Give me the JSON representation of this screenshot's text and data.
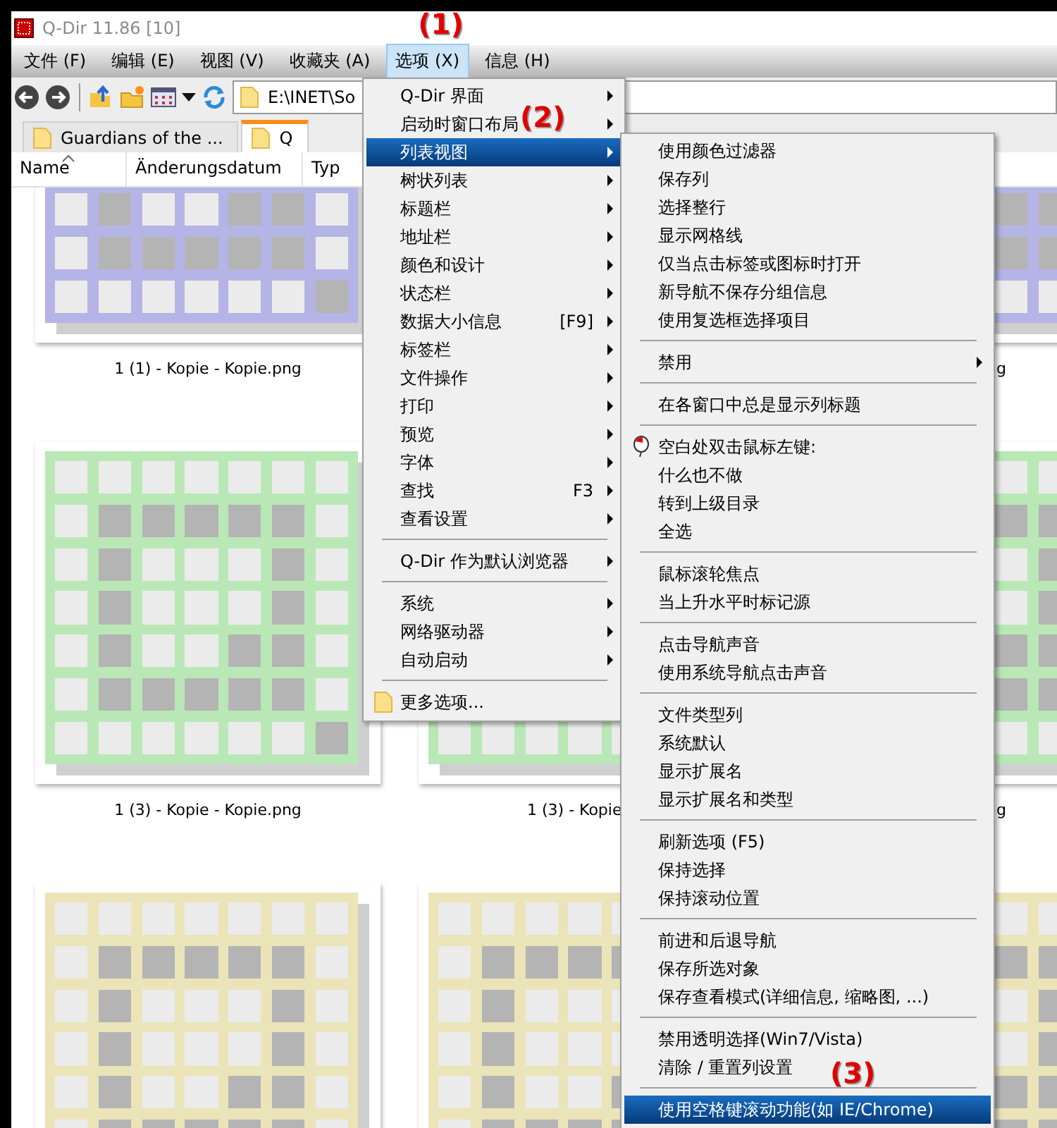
{
  "window": {
    "title": "Q-Dir 11.86 [10]"
  },
  "menu_bar": [
    {
      "label": "文件 (F)",
      "selected": false
    },
    {
      "label": "编辑 (E)",
      "selected": false
    },
    {
      "label": "视图 (V)",
      "selected": false
    },
    {
      "label": "收藏夹 (A)",
      "selected": false
    },
    {
      "label": "选项 (X)",
      "selected": true,
      "annotation": "(1)"
    },
    {
      "label": "信息 (H)",
      "selected": false
    }
  ],
  "toolbar": {
    "address": "E:\\INET\\So"
  },
  "tabs": [
    {
      "label": "Guardians of the ...",
      "selected": false
    },
    {
      "label": "Q",
      "selected": true
    }
  ],
  "columns": [
    "Name",
    "Änderungsdatum",
    "Typ"
  ],
  "thumbnails": [
    {
      "color": "#b4b4e6",
      "label": "1 (1) - Kopie - Kopie.png"
    },
    {
      "color": "#b4b4e6",
      "label": "g"
    },
    {
      "color": "#b9e8b6",
      "label": "1 (3) - Kopie - Kopie.png"
    },
    {
      "color": "#b9e8b6",
      "label": "1 (3) - Kopie"
    },
    {
      "color": "#b9e8b6",
      "label": "g"
    },
    {
      "color": "#ebe4b9"
    },
    {
      "color": "#ebe4b9"
    },
    {
      "color": "#ebe4b9"
    }
  ],
  "options_menu": [
    {
      "kind": "item",
      "label": "Q-Dir 界面",
      "submenu": true,
      "selected": false
    },
    {
      "kind": "item",
      "label": "启动时窗口布局",
      "submenu": true,
      "selected": false,
      "annotation": "(2)"
    },
    {
      "kind": "item",
      "label": "列表视图",
      "submenu": true,
      "selected": true
    },
    {
      "kind": "item",
      "label": "树状列表",
      "submenu": true,
      "selected": false
    },
    {
      "kind": "item",
      "label": "标题栏",
      "submenu": true,
      "selected": false
    },
    {
      "kind": "item",
      "label": "地址栏",
      "submenu": true,
      "selected": false
    },
    {
      "kind": "item",
      "label": "颜色和设计",
      "submenu": true,
      "selected": false
    },
    {
      "kind": "item",
      "label": "状态栏",
      "submenu": true,
      "selected": false
    },
    {
      "kind": "item",
      "label": "数据大小信息",
      "shortcut": "[F9]",
      "submenu": true,
      "selected": false
    },
    {
      "kind": "item",
      "label": "标签栏",
      "submenu": true,
      "selected": false
    },
    {
      "kind": "item",
      "label": "文件操作",
      "submenu": true,
      "selected": false
    },
    {
      "kind": "item",
      "label": "打印",
      "submenu": true,
      "selected": false
    },
    {
      "kind": "item",
      "label": "预览",
      "submenu": true,
      "selected": false
    },
    {
      "kind": "item",
      "label": "字体",
      "submenu": true,
      "selected": false
    },
    {
      "kind": "item",
      "label": "查找",
      "shortcut": "F3",
      "submenu": true,
      "selected": false
    },
    {
      "kind": "item",
      "label": "查看设置",
      "submenu": true,
      "selected": false
    },
    {
      "kind": "separator"
    },
    {
      "kind": "item",
      "label": "Q-Dir 作为默认浏览器",
      "submenu": true,
      "selected": false
    },
    {
      "kind": "separator"
    },
    {
      "kind": "item",
      "label": "系统",
      "submenu": true,
      "selected": false
    },
    {
      "kind": "item",
      "label": "网络驱动器",
      "submenu": true,
      "selected": false
    },
    {
      "kind": "item",
      "label": "自动启动",
      "submenu": true,
      "selected": false
    },
    {
      "kind": "separator"
    },
    {
      "kind": "folder",
      "label": "更多选项...",
      "submenu": false,
      "selected": false
    }
  ],
  "list_view_submenu": [
    {
      "kind": "item",
      "label": "使用颜色过滤器",
      "submenu": false,
      "selected": false
    },
    {
      "kind": "item",
      "label": "保存列",
      "submenu": false,
      "selected": false
    },
    {
      "kind": "item",
      "label": "选择整行",
      "submenu": false,
      "selected": false
    },
    {
      "kind": "item",
      "label": "显示网格线",
      "submenu": false,
      "selected": false
    },
    {
      "kind": "item",
      "label": "仅当点击标签或图标时打开",
      "submenu": false,
      "selected": false
    },
    {
      "kind": "item",
      "label": "新导航不保存分组信息",
      "submenu": false,
      "selected": false
    },
    {
      "kind": "item",
      "label": "使用复选框选择项目",
      "submenu": false,
      "selected": false
    },
    {
      "kind": "separator"
    },
    {
      "kind": "item",
      "label": "禁用",
      "submenu": true,
      "selected": false
    },
    {
      "kind": "separator"
    },
    {
      "kind": "item",
      "label": "在各窗口中总是显示列标题",
      "submenu": false,
      "selected": false
    },
    {
      "kind": "separator"
    },
    {
      "kind": "header",
      "label": "空白处双击鼠标左键:",
      "submenu": false,
      "selected": false
    },
    {
      "kind": "item",
      "label": "什么也不做",
      "submenu": false,
      "selected": false
    },
    {
      "kind": "item",
      "label": "转到上级目录",
      "submenu": false,
      "selected": false
    },
    {
      "kind": "item",
      "label": "全选",
      "submenu": false,
      "selected": false
    },
    {
      "kind": "separator"
    },
    {
      "kind": "item",
      "label": "鼠标滚轮焦点",
      "submenu": false,
      "selected": false
    },
    {
      "kind": "item",
      "label": "当上升水平时标记源",
      "submenu": false,
      "selected": false
    },
    {
      "kind": "separator"
    },
    {
      "kind": "item",
      "label": "点击导航声音",
      "submenu": false,
      "selected": false
    },
    {
      "kind": "item",
      "label": "使用系统导航点击声音",
      "submenu": false,
      "selected": false
    },
    {
      "kind": "separator"
    },
    {
      "kind": "item",
      "label": "文件类型列",
      "submenu": false,
      "selected": false
    },
    {
      "kind": "item",
      "label": "系统默认",
      "submenu": false,
      "selected": false
    },
    {
      "kind": "item",
      "label": "显示扩展名",
      "submenu": false,
      "selected": false
    },
    {
      "kind": "item",
      "label": "显示扩展名和类型",
      "submenu": false,
      "selected": false
    },
    {
      "kind": "separator"
    },
    {
      "kind": "item",
      "label": "刷新选项 (F5)",
      "submenu": false,
      "selected": false
    },
    {
      "kind": "item",
      "label": "保持选择",
      "submenu": false,
      "selected": false
    },
    {
      "kind": "item",
      "label": "保持滚动位置",
      "submenu": false,
      "selected": false
    },
    {
      "kind": "separator"
    },
    {
      "kind": "item",
      "label": "前进和后退导航",
      "submenu": false,
      "selected": false
    },
    {
      "kind": "item",
      "label": "保存所选对象",
      "submenu": false,
      "selected": false
    },
    {
      "kind": "item",
      "label": "保存查看模式(详细信息, 缩略图, ...)",
      "submenu": false,
      "selected": false
    },
    {
      "kind": "separator"
    },
    {
      "kind": "item",
      "label": "禁用透明选择(Win7/Vista)",
      "submenu": false,
      "selected": false
    },
    {
      "kind": "item",
      "label": "清除 / 重置列设置",
      "submenu": false,
      "selected": false,
      "annotation": "(3)"
    },
    {
      "kind": "separator"
    },
    {
      "kind": "item",
      "label": "使用空格键滚动功能(如 IE/Chrome)",
      "submenu": false,
      "selected": true
    }
  ]
}
